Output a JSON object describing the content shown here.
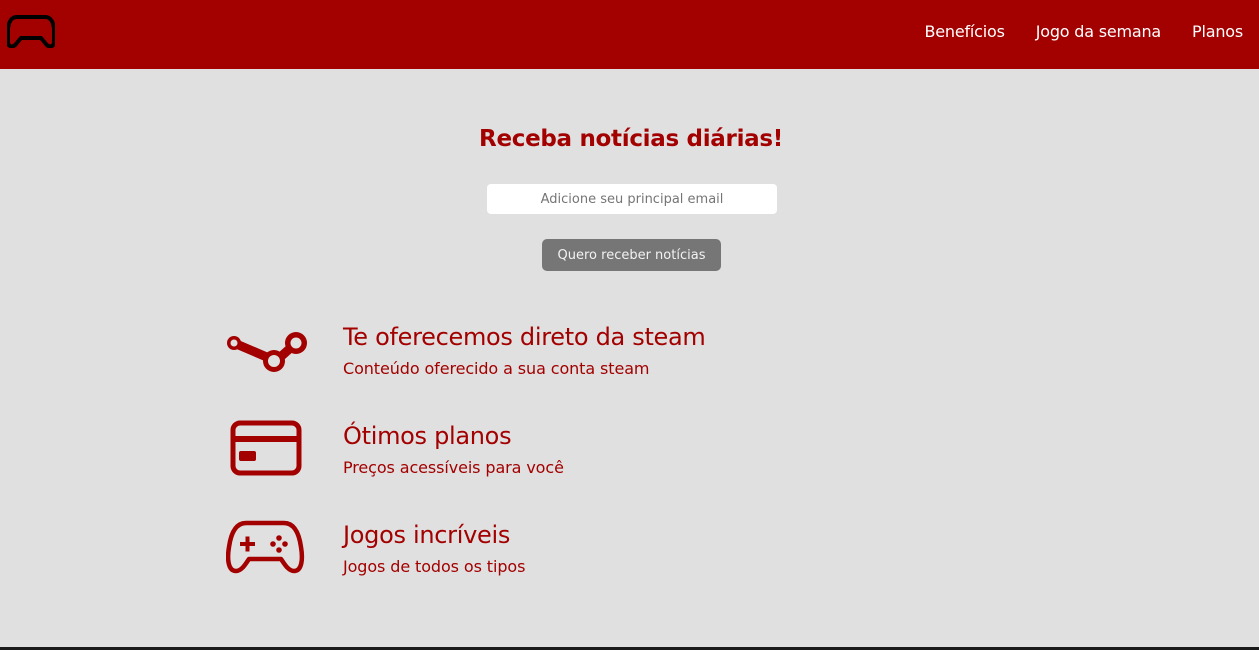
{
  "header": {
    "logo_icon": "gamepad-icon",
    "nav": [
      {
        "label": "Benefícios"
      },
      {
        "label": "Jogo da semana"
      },
      {
        "label": "Planos"
      }
    ]
  },
  "newsletter": {
    "title": "Receba notícias diárias!",
    "email_placeholder": "Adicione seu principal email",
    "button_label": "Quero receber notícias"
  },
  "features": [
    {
      "icon": "steam-icon",
      "title": "Te oferecemos direto da steam",
      "description": "Conteúdo oferecido a sua conta steam"
    },
    {
      "icon": "credit-card-icon",
      "title": "Ótimos planos",
      "description": "Preços acessíveis para você"
    },
    {
      "icon": "gamepad-icon",
      "title": "Jogos incríveis",
      "description": "Jogos de todos os tipos"
    }
  ],
  "colors": {
    "brand": "#a30000",
    "background": "#e0e0e0",
    "button": "#767676"
  }
}
